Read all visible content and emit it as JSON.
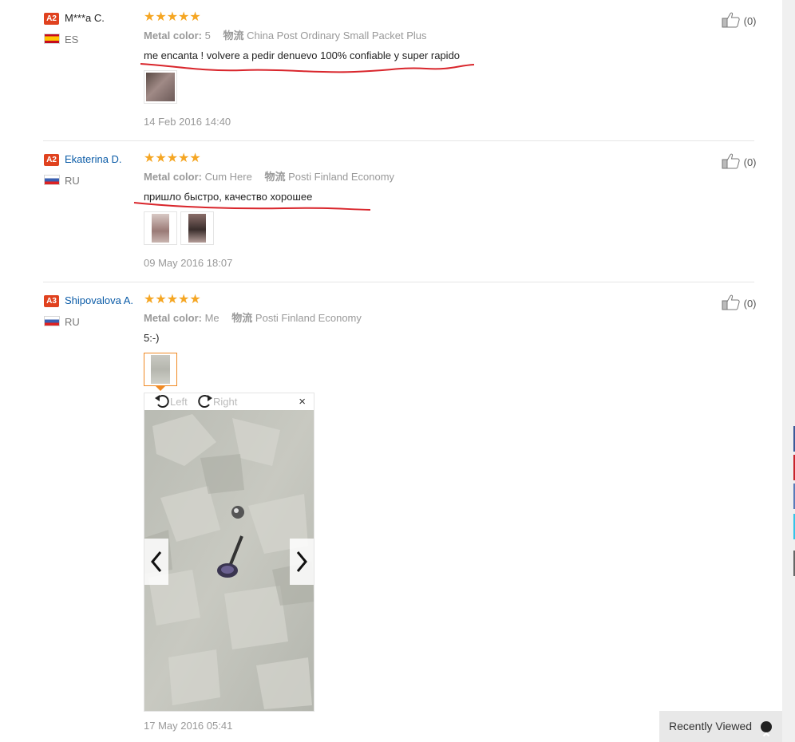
{
  "reviews": [
    {
      "level": "A2",
      "name": "M***a C.",
      "country": "ES",
      "stars": "★★★★★",
      "meta_label": "Metal color:",
      "meta_value": "5",
      "logistics_label": "物流",
      "logistics_value": "China Post Ordinary Small Packet Plus",
      "text": "me encanta ! volvere a pedir denuevo 100% confiable y super rapido",
      "date": "14 Feb 2016 14:40",
      "likes": "(0)"
    },
    {
      "level": "A2",
      "name": "Ekaterina D.",
      "country": "RU",
      "stars": "★★★★★",
      "meta_label": "Metal color:",
      "meta_value": "Cum Here",
      "logistics_label": "物流",
      "logistics_value": "Posti Finland Economy",
      "text": "пришло быстро, качество хорошее",
      "date": "09 May 2016 18:07",
      "likes": "(0)"
    },
    {
      "level": "A3",
      "name": "Shipovalova A.",
      "country": "RU",
      "stars": "★★★★★",
      "meta_label": "Metal color:",
      "meta_value": "Me",
      "logistics_label": "物流",
      "logistics_value": "Posti Finland Economy",
      "text": "5:-)",
      "date": "17 May 2016 05:41",
      "likes": "(0)"
    }
  ],
  "viewer": {
    "rotate_left": "Left",
    "rotate_right": "Right",
    "close": "×"
  },
  "recently_viewed": "Recently Viewed",
  "colors": {
    "accent_orange": "#f5a623",
    "badge_red": "#e0421f",
    "link_blue": "#0a5ba7",
    "underline_red": "#d9262c"
  }
}
